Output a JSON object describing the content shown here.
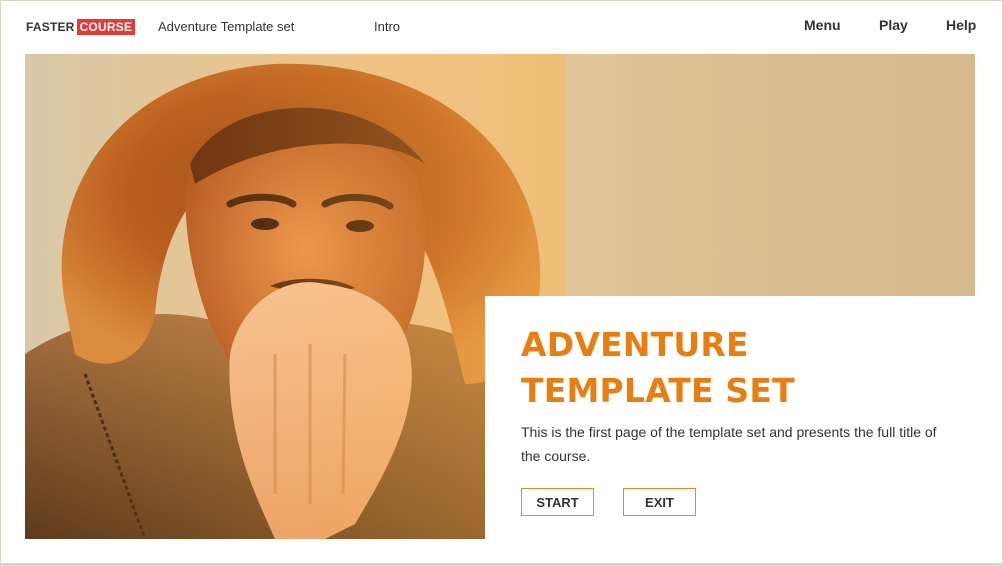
{
  "header": {
    "logo_part1": "FASTER",
    "logo_part2": "COURSE",
    "course_title": "Adventure Template set",
    "section_title": "Intro",
    "nav": {
      "menu": "Menu",
      "play": "Play",
      "help": "Help"
    }
  },
  "hero": {
    "title_line1": "ADVENTURE",
    "title_line2": "TEMPLATE SET",
    "description": "This is the first page of the template set and presents the full title of the course.",
    "start_label": "START",
    "exit_label": "EXIT"
  },
  "colors": {
    "accent": "#e67e12",
    "logo_red": "#e23b3b",
    "button_border": "#e08a2b"
  }
}
